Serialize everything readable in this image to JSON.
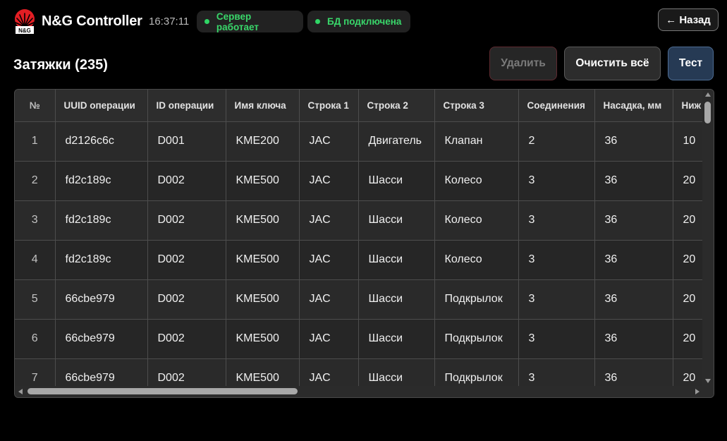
{
  "header": {
    "logo_text": "N&G",
    "app_title": "N&G Controller",
    "time": "16:37:11",
    "status": {
      "server": "Сервер работает",
      "database": "БД подключена",
      "ok_color": "#2fd665"
    },
    "back_button": "← Назад"
  },
  "toolbar": {
    "title": "Затяжки (235)",
    "delete_label": "Удалить",
    "clear_all_label": "Очистить всё",
    "test_label": "Тест"
  },
  "table": {
    "columns": [
      "№",
      "UUID операции",
      "ID операции",
      "Имя ключа",
      "Строка 1",
      "Строка 2",
      "Строка 3",
      "Соединения",
      "Насадка, мм",
      "Ниж"
    ],
    "rows": [
      [
        "1",
        "d2126c6c",
        "D001",
        "KME200",
        "JAC",
        "Двигатель",
        "Клапан",
        "2",
        "36",
        "10"
      ],
      [
        "2",
        "fd2c189c",
        "D002",
        "KME500",
        "JAC",
        "Шасси",
        "Колесо",
        "3",
        "36",
        "20"
      ],
      [
        "3",
        "fd2c189c",
        "D002",
        "KME500",
        "JAC",
        "Шасси",
        "Колесо",
        "3",
        "36",
        "20"
      ],
      [
        "4",
        "fd2c189c",
        "D002",
        "KME500",
        "JAC",
        "Шасси",
        "Колесо",
        "3",
        "36",
        "20"
      ],
      [
        "5",
        "66cbe979",
        "D002",
        "KME500",
        "JAC",
        "Шасси",
        "Подкрылок",
        "3",
        "36",
        "20"
      ],
      [
        "6",
        "66cbe979",
        "D002",
        "KME500",
        "JAC",
        "Шасси",
        "Подкрылок",
        "3",
        "36",
        "20"
      ],
      [
        "7",
        "66cbe979",
        "D002",
        "KME500",
        "JAC",
        "Шасси",
        "Подкрылок",
        "3",
        "36",
        "20"
      ]
    ]
  }
}
